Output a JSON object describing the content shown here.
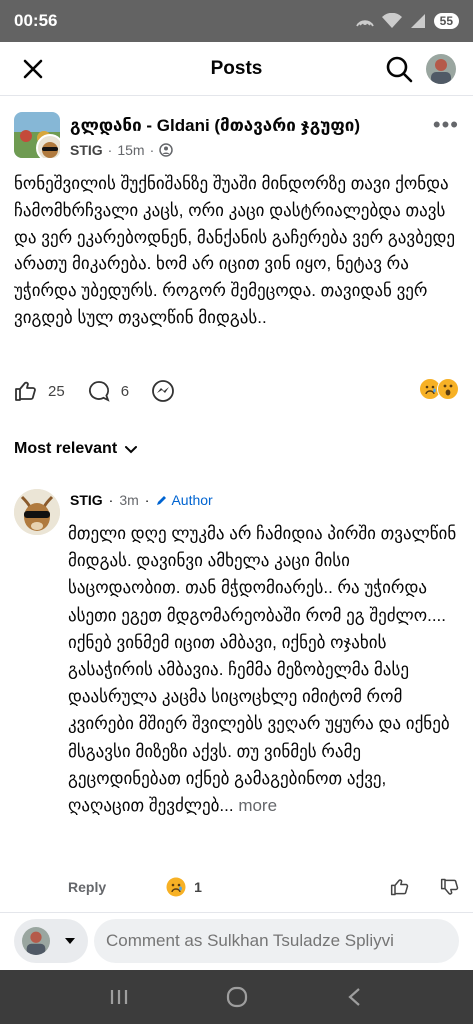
{
  "status_bar": {
    "time": "00:56",
    "battery": "55"
  },
  "header": {
    "title": "Posts"
  },
  "post": {
    "group_name": "გლდანი - Gldani (მთავარი ჯგუფი)",
    "author": "STIG",
    "time": "15m",
    "text": "ნონეშვილის შუქნიშანზე შუაში მინდორზე თავი ქონდა ჩამომხრჩვალი კაცს, ორი კაცი დასტრიალებდა თავს და ვერ ეკარებოდნენ, მანქანის გაჩერება ვერ გავბედე არათუ მიკარება. ხომ არ იცით ვინ იყო, ნეტავ რა უჭირდა უბედურს. როგორ შემეცოდა. თავიდან ვერ ვიგდებ სულ თვალწინ მიდგას..",
    "like_count": "25",
    "comment_count": "6"
  },
  "comments_section": {
    "sort_label": "Most relevant",
    "comment": {
      "author": "STIG",
      "time": "3m",
      "badge": "Author",
      "text": "მთელი დღე ლუკმა არ ჩამიდია პირში თვალწინ მიდგას. დავინვი ამხელა კაცი მისი საცოდაობით. თან მჭდომიარეს.. რა უჭირდა ასეთი ეგეთ მდგომარეობაში რომ ეგ შეძლო.... იქნებ ვინმემ იცით ამბავი, იქნებ ოჯახის გასაჭირის ამბავია. ჩემმა მეზობელმა მასე დაასრულა კაცმა სიცოცხლე იმიტომ რომ კვირები მშიერ შვილებს ვეღარ უყურა და იქნებ მსგავსი მიზეზი აქვს. თუ ვინმეს რამე გეცოდინებათ იქნებ გამაგებინოთ აქვე, ღაღაცით შევძლებ...",
      "more_label": "more",
      "reply_label": "Reply",
      "reaction_count": "1"
    }
  },
  "composer": {
    "placeholder": "Comment as Sulkhan Tsuladze Spliyvi"
  },
  "colors": {
    "accent": "#0064d1",
    "status_bar": "#636363",
    "nav_bar": "#3c3c3c"
  }
}
